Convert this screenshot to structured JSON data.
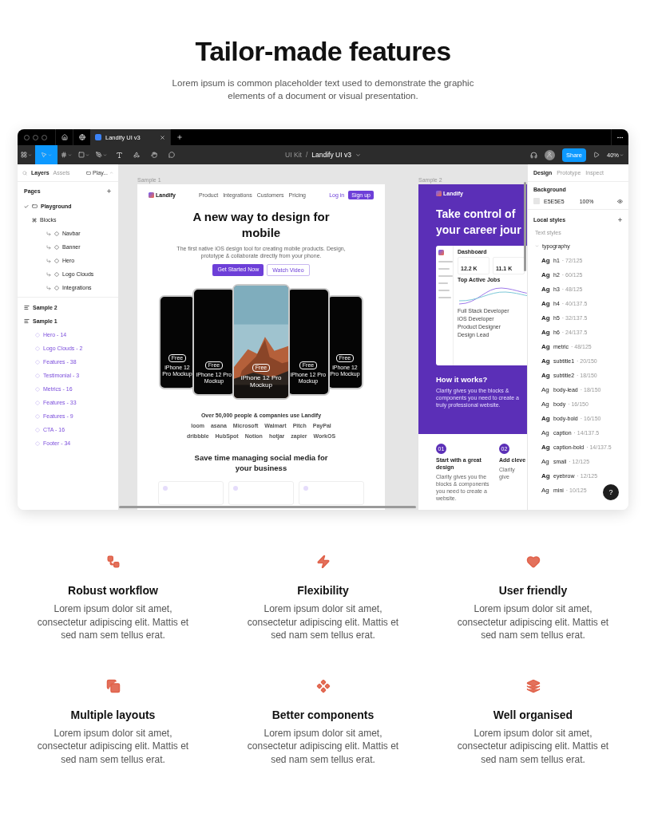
{
  "header": {
    "title": "Tailor-made features",
    "subtitle": "Lorem ipsum is common placeholder text used to demonstrate the graphic elements of a document or visual presentation."
  },
  "app": {
    "tabs": [
      {
        "label": "Landify UI v3",
        "selected": true
      }
    ],
    "toolbar": {
      "project": "UI Kit",
      "separator": "/",
      "file": "Landify UI v3",
      "share": "Share",
      "zoom": "40%"
    },
    "left_panel": {
      "tabs": [
        {
          "label": "Layers",
          "selected": true
        },
        {
          "label": "Assets",
          "selected": false
        }
      ],
      "page_switch": "Play...",
      "pages_title": "Pages",
      "pages": [
        {
          "label": "Playground",
          "kind": "page",
          "selected": true
        },
        {
          "label": "Blocks",
          "kind": "group",
          "selected": false,
          "children": [
            {
              "label": "Navbar",
              "selected": false
            },
            {
              "label": "Banner",
              "selected": false
            },
            {
              "label": "Hero",
              "selected": false
            },
            {
              "label": "Logo Clouds",
              "selected": false
            },
            {
              "label": "Integrations",
              "selected": false
            }
          ]
        }
      ],
      "layers": [
        {
          "label": "Sample 2"
        },
        {
          "label": "Sample 1",
          "children": [
            {
              "label": "Hero - 14"
            },
            {
              "label": "Logo Clouds - 2"
            },
            {
              "label": "Features - 38"
            },
            {
              "label": "Testimonial - 3"
            },
            {
              "label": "Metrics - 16"
            },
            {
              "label": "Features - 33"
            },
            {
              "label": "Features - 9"
            },
            {
              "label": "CTA - 16"
            },
            {
              "label": "Footer - 34"
            }
          ]
        }
      ]
    },
    "sample_1": {
      "label": "Sample 1",
      "brand": "Landify",
      "nav": [
        "Product",
        "Integrations",
        "Customers",
        "Pricing"
      ],
      "login": "Log in",
      "signup": "Sign up",
      "headline": "A new way to design for mobile",
      "description": "The first native iOS design tool for creating mobile products. Design, prototype & collaborate directly from your phone.",
      "primary": "Get Started Now",
      "secondary": "Watch Video",
      "phones": [
        {
          "kind": "plain",
          "badge": "Free",
          "label": "iPhone 12 Pro Mockup"
        },
        {
          "kind": "plain",
          "badge": "Free",
          "label": "iPhone 12 Pro Mockup"
        },
        {
          "badge": "Free",
          "label": "iPhone 12 Pro Mockup"
        },
        {
          "kind": "plain",
          "badge": "Free",
          "label": "iPhone 12 Pro Mockup"
        },
        {
          "kind": "plain",
          "badge": "Free",
          "label": "iPhone 12 Pro Mockup"
        }
      ],
      "trust": "Over 50,000 people & companies use Landify",
      "logos": [
        [
          "loom",
          "asana",
          "Microsoft",
          "Walmart",
          "Pitch",
          "PayPal"
        ],
        [
          "dribbble",
          "HubSpot",
          "Notion",
          "hotjar",
          "zapier",
          "WorkOS"
        ]
      ],
      "section_title": "Save time managing social media for your business"
    },
    "sample_2": {
      "label": "Sample 2",
      "brand": "Landify",
      "headline": [
        "Take control of",
        "your career jour"
      ],
      "dashboard": {
        "title": "Dashboard",
        "metrics": [
          "12.2 K",
          "11.1 K"
        ],
        "chart_title": "Top Active Jobs",
        "jobs": [
          "Full Stack Developer",
          "iOS Developer",
          "Product Designer",
          "Design Lead"
        ]
      },
      "section_title": "How it works?",
      "section_text": "Clarity gives you the blocks & components you need to create a truly professional website.",
      "steps": [
        {
          "number": "01",
          "title": "Start with a great design",
          "text": "Clarity gives you the blocks & components you need to create a website."
        },
        {
          "number": "02",
          "title": "Add cleve",
          "text": "Clarity give"
        }
      ]
    },
    "right_panel": {
      "tabs": [
        {
          "label": "Design",
          "selected": true
        },
        {
          "label": "Prototype",
          "selected": false
        },
        {
          "label": "Inspect",
          "selected": false
        }
      ],
      "background_title": "Background",
      "background": {
        "hex": "E5E5E5",
        "color": "#e5e5e5",
        "opacity": "100%"
      },
      "local_styles": "Local styles",
      "text_styles": "Text styles",
      "group": "typography",
      "styles": [
        {
          "preview": "Ag",
          "name": "h1",
          "spec": "· 72/125",
          "bold": true
        },
        {
          "preview": "Ag",
          "name": "h2",
          "spec": "· 60/125",
          "bold": true
        },
        {
          "preview": "Ag",
          "name": "h3",
          "spec": "· 48/125",
          "bold": true
        },
        {
          "preview": "Ag",
          "name": "h4",
          "spec": "· 40/137.5",
          "bold": true
        },
        {
          "preview": "Ag",
          "name": "h5",
          "spec": "· 32/137.5",
          "bold": true
        },
        {
          "preview": "Ag",
          "name": "h6",
          "spec": "· 24/137.5",
          "bold": true
        },
        {
          "preview": "Ag",
          "name": "metric",
          "spec": "· 48/125",
          "bold": true
        },
        {
          "preview": "Ag",
          "name": "subtitle1",
          "spec": "· 20/150",
          "bold": true
        },
        {
          "preview": "Ag",
          "name": "subtitle2",
          "spec": "· 18/150",
          "bold": true
        },
        {
          "preview": "Ag",
          "name": "body-lead",
          "spec": "· 18/150",
          "bold": false
        },
        {
          "preview": "Ag",
          "name": "body",
          "spec": "· 16/150",
          "bold": false
        },
        {
          "preview": "Ag",
          "name": "body-bold",
          "spec": "· 16/150",
          "bold": true
        },
        {
          "preview": "Ag",
          "name": "caption",
          "spec": "· 14/137.5",
          "bold": false
        },
        {
          "preview": "Ag",
          "name": "caption-bold",
          "spec": "· 14/137.5",
          "bold": true
        },
        {
          "preview": "Ag",
          "name": "small",
          "spec": "· 12/125",
          "bold": false
        },
        {
          "preview": "Ag",
          "name": "eyebrow",
          "spec": "· 12/125",
          "bold": true
        },
        {
          "preview": "Ag",
          "name": "mini",
          "spec": "· 10/125",
          "bold": false
        }
      ]
    },
    "help": "?"
  },
  "features": [
    {
      "title": "Robust workflow",
      "text": "Lorem ipsum dolor sit amet, consectetur adipiscing elit. Mattis et sed nam sem tellus erat."
    },
    {
      "title": "Flexibility",
      "text": "Lorem ipsum dolor sit amet, consectetur adipiscing elit. Mattis et sed nam sem tellus erat."
    },
    {
      "title": "User friendly",
      "text": "Lorem ipsum dolor sit amet, consectetur adipiscing elit. Mattis et sed nam sem tellus erat."
    },
    {
      "title": "Multiple layouts",
      "text": "Lorem ipsum dolor sit amet, consectetur adipiscing elit. Mattis et sed nam sem tellus erat."
    },
    {
      "title": "Better components",
      "text": "Lorem ipsum dolor sit amet, consectetur adipiscing elit. Mattis et sed nam sem tellus erat."
    },
    {
      "title": "Well organised",
      "text": "Lorem ipsum dolor sit amet, consectetur adipiscing elit. Mattis et sed nam sem tellus erat."
    }
  ]
}
